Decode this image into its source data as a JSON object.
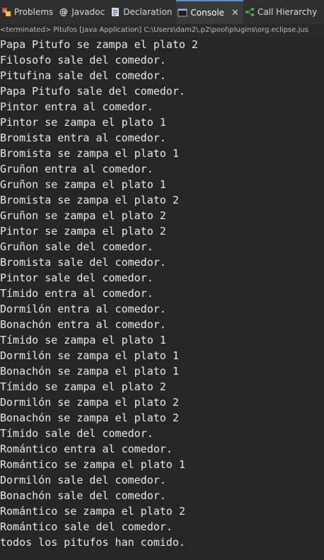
{
  "tabs": [
    {
      "label": "Problems",
      "icon": "problems-icon"
    },
    {
      "label": "Javadoc",
      "icon": "javadoc-icon"
    },
    {
      "label": "Declaration",
      "icon": "declaration-icon"
    },
    {
      "label": "Console",
      "icon": "console-icon",
      "active": true
    },
    {
      "label": "Call Hierarchy",
      "icon": "call-hierarchy-icon"
    }
  ],
  "close_glyph": "✕",
  "status": "<terminated> Pitufos [Java Application] C:\\Users\\dam2\\.p2\\pool\\plugins\\org.eclipse.jus",
  "console_lines": [
    "Papa Pitufo se zampa el plato 2",
    "Filosofo sale del comedor.",
    "Pitufina sale del comedor.",
    "Papa Pitufo sale del comedor.",
    "Pintor entra al comedor.",
    "Pintor se zampa el plato 1",
    "Bromista entra al comedor.",
    "Bromista se zampa el plato 1",
    "Gruñon entra al comedor.",
    "Gruñon se zampa el plato 1",
    "Bromista se zampa el plato 2",
    "Gruñon se zampa el plato 2",
    "Pintor se zampa el plato 2",
    "Gruñon sale del comedor.",
    "Bromista sale del comedor.",
    "Pintor sale del comedor.",
    "Tímido entra al comedor.",
    "Dormilón entra al comedor.",
    "Bonachón entra al comedor.",
    "Tímido se zampa el plato 1",
    "Dormilón se zampa el plato 1",
    "Bonachón se zampa el plato 1",
    "Tímido se zampa el plato 2",
    "Dormilón se zampa el plato 2",
    "Bonachón se zampa el plato 2",
    "Tímido sale del comedor.",
    "Romántico entra al comedor.",
    "Romántico se zampa el plato 1",
    "Dormilón sale del comedor.",
    "Bonachón sale del comedor.",
    "Romántico se zampa el plato 2",
    "Romántico sale del comedor.",
    "todos los pitufos han comido."
  ],
  "colors": {
    "background": "#262626",
    "text": "#e8e8e8",
    "active_tab_accent": "#5a8fd6"
  }
}
